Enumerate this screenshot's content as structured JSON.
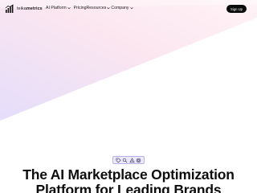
{
  "brand": {
    "name_light": "teika",
    "name_bold": "metrics"
  },
  "nav": {
    "items": [
      {
        "label": "AI Platform"
      },
      {
        "label": "Pricing"
      },
      {
        "label": "Resources"
      },
      {
        "label": "Company"
      }
    ],
    "signup_label": "Sign Up"
  },
  "hero": {
    "badges": [
      "tag-icon",
      "search-icon",
      "triangle-icon",
      "target-icon"
    ],
    "headline_line1": "The AI Marketplace Optimization",
    "headline_line2": "Platform for Leading Brands"
  },
  "colors": {
    "accent": "#8b7fe0",
    "background_gradient_start": "#fde8f1",
    "background_gradient_end": "#e3ddfb",
    "button_bg": "#0b0b0b"
  }
}
